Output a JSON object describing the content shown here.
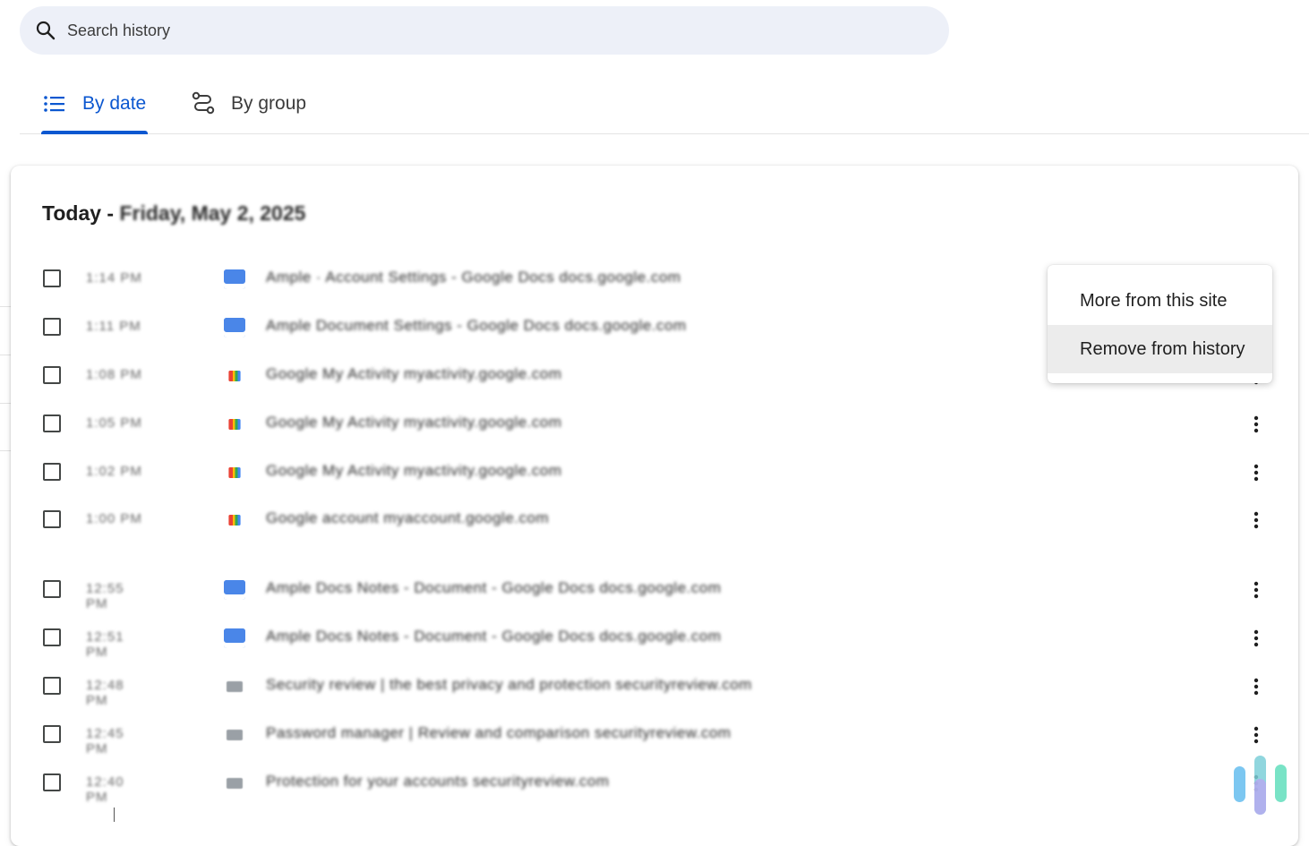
{
  "search": {
    "placeholder": "Search history"
  },
  "tabs": [
    {
      "label": "By date",
      "icon": "list-icon",
      "active": true
    },
    {
      "label": "By group",
      "icon": "group-journeys-icon",
      "active": false
    }
  ],
  "card": {
    "title_prefix": "Today - ",
    "title_date": "Friday, May 2, 2025"
  },
  "rows": [
    {
      "time": "1:14 PM",
      "title": "Ample · Account Settings - Google Docs  docs.google.com",
      "favicon": "docs-icon"
    },
    {
      "time": "1:11 PM",
      "title": "Ample Document Settings - Google Docs  docs.google.com",
      "favicon": "docs-icon"
    },
    {
      "time": "1:08 PM",
      "title": "Google My Activity  myactivity.google.com",
      "favicon": "google-icon"
    },
    {
      "time": "1:05 PM",
      "title": "Google My Activity  myactivity.google.com",
      "favicon": "google-icon"
    },
    {
      "time": "1:02 PM",
      "title": "Google My Activity  myactivity.google.com",
      "favicon": "google-icon"
    },
    {
      "time": "1:00 PM",
      "title": "Google account  myaccount.google.com",
      "favicon": "google-icon"
    },
    {
      "time": "12:55 PM",
      "title": "Ample Docs Notes - Document - Google Docs  docs.google.com",
      "favicon": "docs-icon"
    },
    {
      "time": "12:51 PM",
      "title": "Ample Docs Notes - Document - Google Docs  docs.google.com",
      "favicon": "docs-icon"
    },
    {
      "time": "12:48 PM",
      "title": "Security review | the best privacy and protection  securityreview.com",
      "favicon": "site-icon"
    },
    {
      "time": "12:45 PM",
      "title": "Password manager | Review and comparison  securityreview.com",
      "favicon": "site-icon"
    },
    {
      "time": "12:40 PM",
      "title": "Protection for your accounts  securityreview.com",
      "favicon": "site-icon"
    }
  ],
  "menu": {
    "items": [
      "More from this site",
      "Remove from history"
    ],
    "highlighted": 1
  },
  "colors": {
    "accent": "#0b57d0",
    "search_bg": "#edf0f8",
    "menu_highlight": "#ececec"
  },
  "icons": {
    "search": "search-icon",
    "more": "more-vert-icon",
    "logo": "brand-logo-icon"
  }
}
